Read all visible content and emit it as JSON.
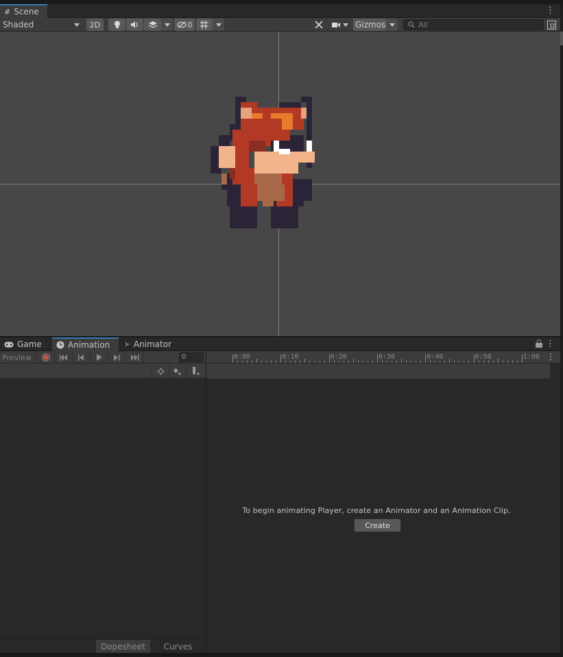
{
  "scene": {
    "tab_label": "Scene",
    "shading_mode": "Shaded",
    "mode_2d": "2D",
    "hidden_count": "0",
    "gizmos_label": "Gizmos",
    "search_placeholder": "All"
  },
  "bottom_tabs": {
    "game": "Game",
    "animation": "Animation",
    "animator": "Animator"
  },
  "animation": {
    "preview_label": "Preview",
    "frame_value": "0",
    "timeline_ticks": [
      "0:00",
      "0:10",
      "0:20",
      "0:30",
      "0:40",
      "0:50",
      "1:00"
    ],
    "message": "To begin animating Player, create an Animator and an Animation Clip.",
    "create_label": "Create",
    "view_tabs": {
      "dopesheet": "Dopesheet",
      "curves": "Curves"
    }
  },
  "colors": {
    "viewport_bg": "#474747",
    "panel_bg": "#282828",
    "toolbar_bg": "#3c3c3c",
    "active_tab_accent": "#3a79bb",
    "record_red": "#c0564a"
  }
}
